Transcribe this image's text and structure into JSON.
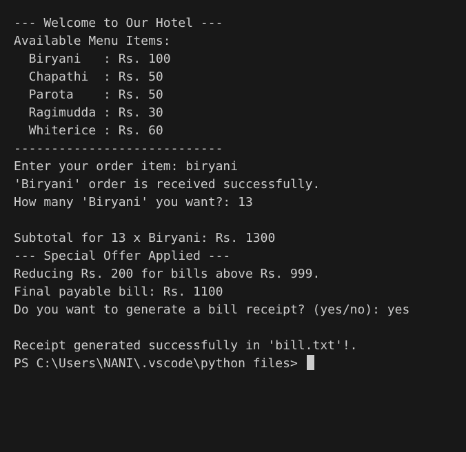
{
  "terminal": {
    "lines": [
      "--- Welcome to Our Hotel ---",
      "Available Menu Items:",
      "  Biryani   : Rs. 100",
      "  Chapathi  : Rs. 50",
      "  Parota    : Rs. 50",
      "  Ragimudda : Rs. 30",
      "  Whiterice : Rs. 60",
      "----------------------------",
      "Enter your order item: biryani",
      "'Biryani' order is received successfully.",
      "How many 'Biryani' you want?: 13",
      "",
      "Subtotal for 13 x Biryani: Rs. 1300",
      "--- Special Offer Applied ---",
      "Reducing Rs. 200 for bills above Rs. 999.",
      "Final payable bill: Rs. 1100",
      "Do you want to generate a bill receipt? (yes/no): yes",
      "",
      "Receipt generated successfully in 'bill.txt'!.",
      "PS C:\\Users\\NANI\\.vscode\\python files> "
    ]
  },
  "colors": {
    "background": "#181818",
    "text": "#cccccc",
    "cursor": "#cccccc"
  }
}
